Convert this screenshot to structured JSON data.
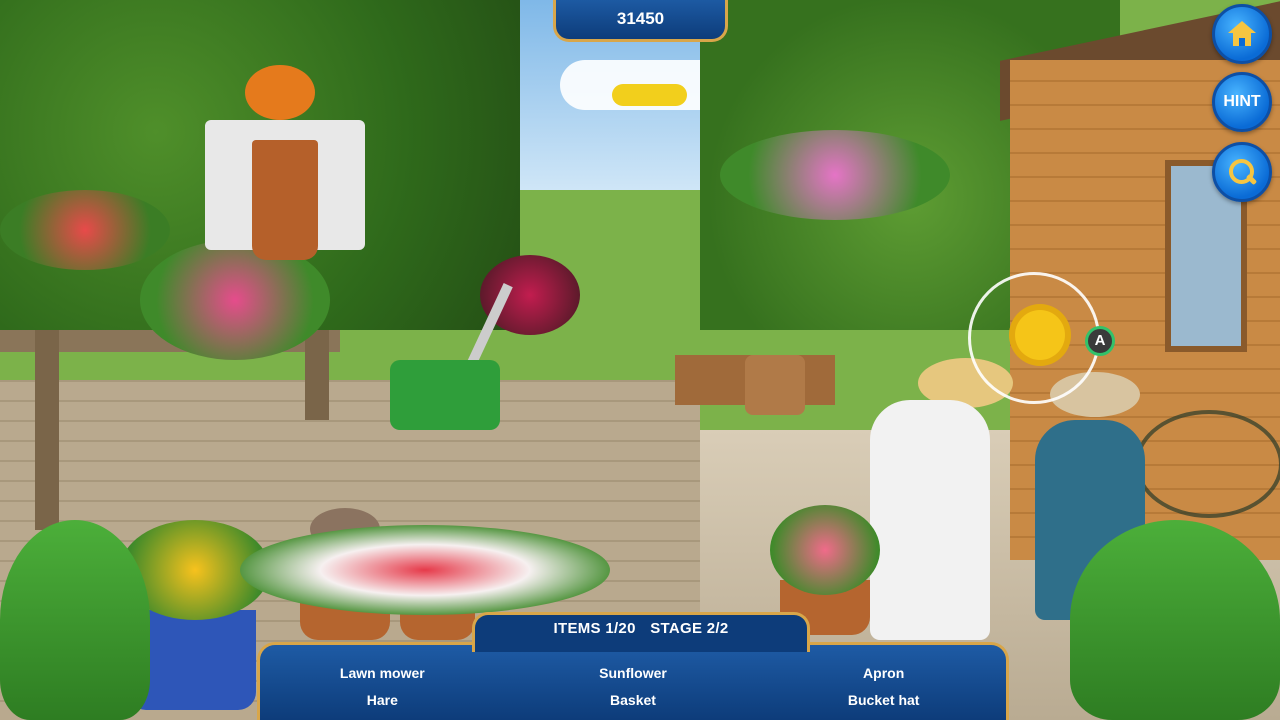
{
  "score": "31450",
  "buttons": {
    "home_icon": "house-icon",
    "hint_label": "HINT",
    "zoom_icon": "magnifier-icon"
  },
  "marker_label": "A",
  "status": {
    "items": "ITEMS 1/20",
    "stage": "STAGE 2/2"
  },
  "item_list": [
    "Lawn mower",
    "Sunflower",
    "Apron",
    "Hare",
    "Basket",
    "Bucket hat"
  ],
  "colors": {
    "panel_blue": "#0d3c7a",
    "panel_border_gold": "#d8a64a",
    "button_blue": "#0a6bd6",
    "icon_yellow": "#f5c542"
  }
}
